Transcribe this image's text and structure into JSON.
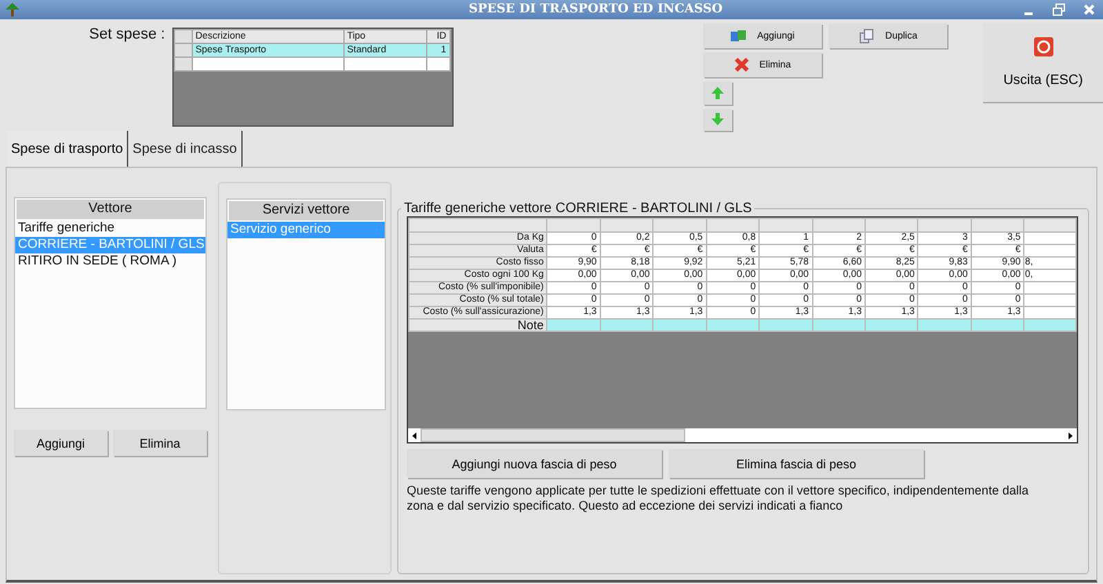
{
  "window": {
    "title": "SPESE DI TRASPORTO ED INCASSO"
  },
  "set_spese": {
    "label": "Set spese :",
    "columns": [
      "Descrizione",
      "Tipo",
      "ID"
    ],
    "rows": [
      {
        "cells": [
          "Spese Trasporto",
          "Standard",
          "1"
        ],
        "selected": true
      }
    ]
  },
  "top_buttons": [
    {
      "label": "Aggiungi"
    },
    {
      "label": "Duplica"
    },
    {
      "label": "Elimina"
    }
  ],
  "exit_button": {
    "label": "Uscita (ESC)"
  },
  "tabs": [
    {
      "label": "Spese di trasporto",
      "selected": true
    },
    {
      "label": "Spese di incasso",
      "selected": false
    }
  ],
  "vettore": {
    "header": "Vettore",
    "items": [
      {
        "label": "Tariffe generiche",
        "selected": false
      },
      {
        "label": "CORRIERE - BARTOLINI / GLS",
        "selected": true
      },
      {
        "label": "RITIRO IN SEDE ( ROMA )",
        "selected": false
      }
    ]
  },
  "vettore_buttons": [
    "Aggiungi",
    "Elimina"
  ],
  "servizi": {
    "header": "Servizi vettore",
    "items": [
      {
        "label": "Servizio generico",
        "selected": true
      }
    ]
  },
  "tariffe": {
    "title": "Tariffe generiche vettore CORRIERE - BARTOLINI / GLS",
    "rows": [
      {
        "label": "Da Kg",
        "values": [
          "0",
          "0,2",
          "0,5",
          "0,8",
          "1",
          "2",
          "2,5",
          "3",
          "3,5"
        ]
      },
      {
        "label": "Valuta",
        "values": [
          "€",
          "€",
          "€",
          "€",
          "€",
          "€",
          "€",
          "€",
          "€"
        ]
      },
      {
        "label": "Costo fisso",
        "values": [
          "9,90",
          "8,18",
          "9,92",
          "5,21",
          "5,78",
          "6,60",
          "8,25",
          "9,83",
          "9,90"
        ],
        "cut_value": "8,"
      },
      {
        "label": "Costo ogni 100 Kg",
        "values": [
          "0,00",
          "0,00",
          "0,00",
          "0,00",
          "0,00",
          "0,00",
          "0,00",
          "0,00",
          "0,00"
        ],
        "cut_value": "0,"
      },
      {
        "label": "Costo (% sull'imponibile)",
        "values": [
          "0",
          "0",
          "0",
          "0",
          "0",
          "0",
          "0",
          "0",
          "0"
        ]
      },
      {
        "label": "Costo (% sul totale)",
        "values": [
          "0",
          "0",
          "0",
          "0",
          "0",
          "0",
          "0",
          "0",
          "0"
        ]
      },
      {
        "label": "Costo (% sull'assicurazione)",
        "values": [
          "1,3",
          "1,3",
          "1,3",
          "0",
          "1,3",
          "1,3",
          "1,3",
          "1,3",
          "1,3"
        ]
      },
      {
        "label": "Note",
        "kind": "note"
      }
    ],
    "buttons": [
      "Aggiungi nuova fascia di peso",
      "Elimina fascia di peso"
    ],
    "note": "Queste tariffe vengono applicate per tutte le spedizioni effettuate con il vettore specifico, indipendentemente dalla zona e dal servizio specificato. Questo ad eccezione dei servizi indicati a fianco"
  }
}
